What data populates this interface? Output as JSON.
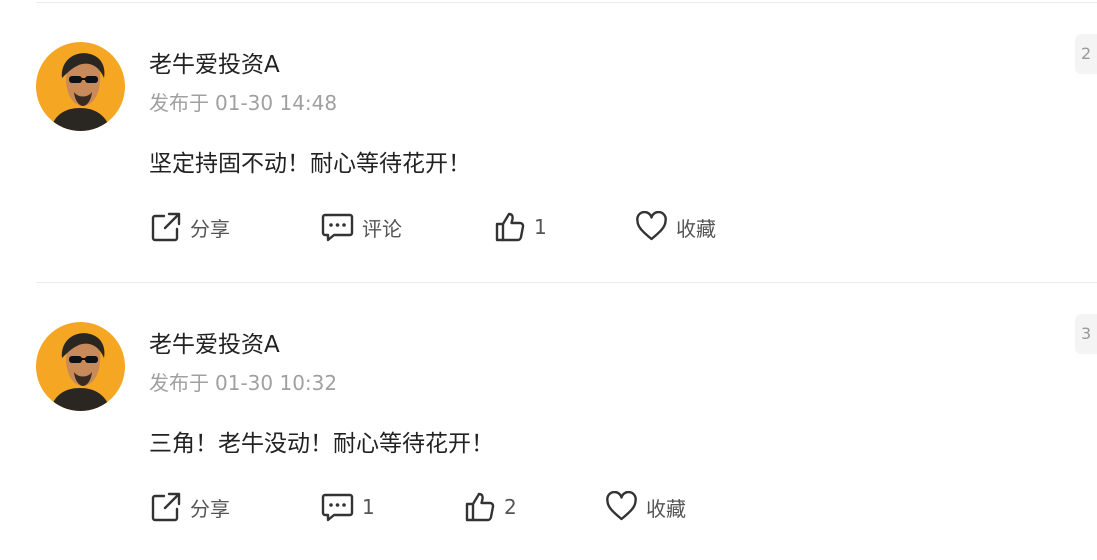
{
  "posts": [
    {
      "author": "老牛爱投资A",
      "time_prefix": "发布于",
      "time": "01-30 14:48",
      "content": "坚定持固不动！耐心等待花开！",
      "floor": "2",
      "share_label": "分享",
      "comment_label": "评论",
      "like_count": "1",
      "favorite_label": "收藏"
    },
    {
      "author": "老牛爱投资A",
      "time_prefix": "发布于",
      "time": "01-30 10:32",
      "content": "三角！老牛没动！耐心等待花开！",
      "floor": "3",
      "share_label": "分享",
      "comment_label": "1",
      "like_count": "2",
      "favorite_label": "收藏"
    }
  ],
  "colors": {
    "avatar_bg": "#f5a623",
    "text_primary": "#222222",
    "text_muted": "#a0a0a0",
    "icon": "#333333",
    "divider": "#ebebeb"
  },
  "icons": {
    "share": "share-icon",
    "comment": "comment-icon",
    "like": "thumbs-up-icon",
    "favorite": "heart-icon"
  }
}
